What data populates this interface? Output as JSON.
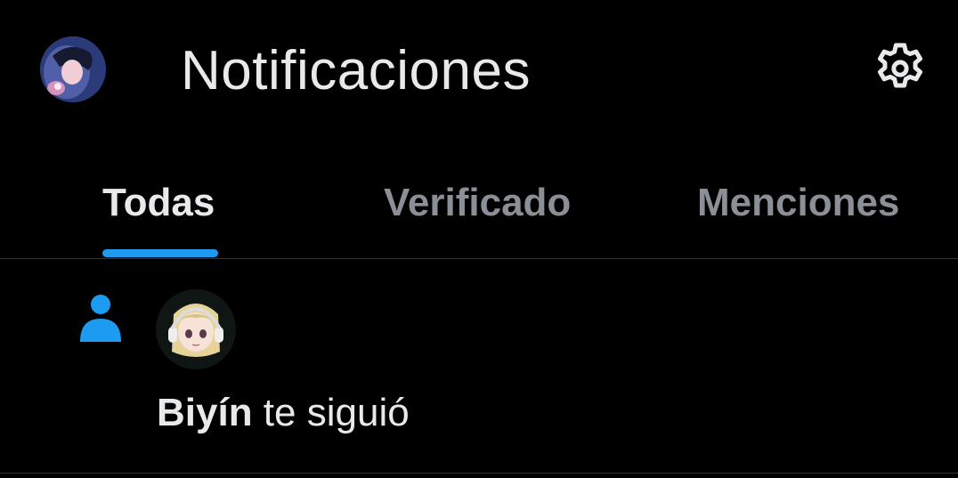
{
  "header": {
    "title": "Notificaciones",
    "avatar_icon": "user-avatar",
    "settings_icon": "gear-icon"
  },
  "tabs": [
    {
      "label": "Todas",
      "active": true
    },
    {
      "label": "Verificado",
      "active": false
    },
    {
      "label": "Menciones",
      "active": false
    }
  ],
  "notifications": [
    {
      "type_icon": "person-follow-icon",
      "user_name": "Biyín",
      "action_text": " te siguió"
    }
  ],
  "colors": {
    "background": "#000000",
    "text_primary": "#e7e9ea",
    "text_secondary": "#8b9096",
    "accent": "#1d9bf0",
    "divider": "#2f3336"
  }
}
